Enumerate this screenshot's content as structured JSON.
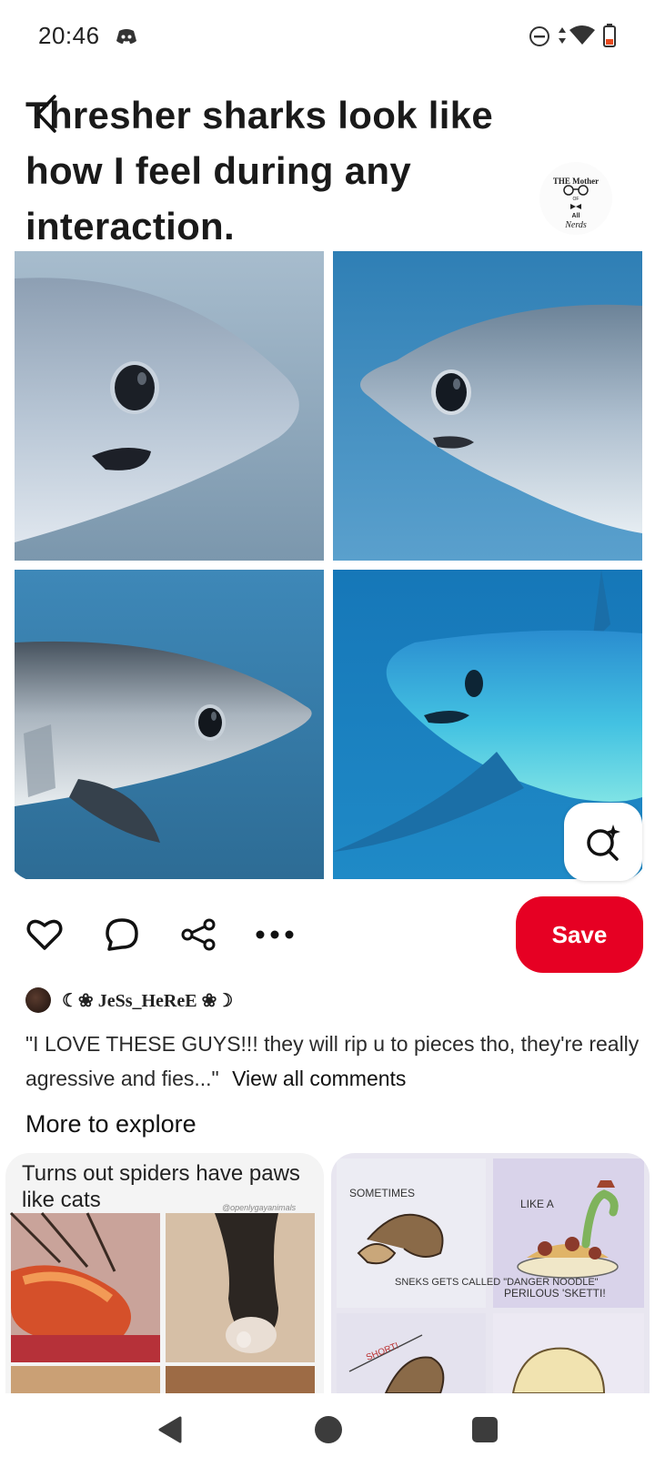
{
  "status_bar": {
    "time": "20:46",
    "icons": [
      "discord-icon",
      "do-not-disturb-icon",
      "data-arrows-icon",
      "wifi-icon",
      "battery-low-icon"
    ],
    "battery_color": "#e8491e"
  },
  "pin": {
    "caption": "Thresher sharks look like how I feel during any interaction.",
    "watermark": "THE Mother OF All Nerds",
    "images": [
      "thresher-shark-photo",
      "thresher-shark-photo",
      "thresher-shark-photo",
      "thresher-shark-photo"
    ]
  },
  "actions": {
    "save_label": "Save",
    "icons": [
      "heart-icon",
      "comment-icon",
      "share-icon",
      "more-icon"
    ],
    "accent_color": "#e60023"
  },
  "comment": {
    "author": "☾❀ JeSs_HeReE ❀☽",
    "text": "\"I LOVE THESE GUYS!!! they will rip u to pieces tho, they're really agressive and fies...\"",
    "view_all": "View all comments"
  },
  "explore": {
    "title": "More to explore",
    "cards": [
      {
        "caption": "Turns out spiders have paws like cats",
        "handle": "@openlygayanimals"
      },
      {
        "texts": [
          "SOMETIMES",
          "SNEKS GETS CALLED \"DANGER NOODLE\"",
          "LIKE A",
          "PERILOUS 'SKETTI!",
          "SHORT!"
        ]
      }
    ]
  },
  "nav_bar": {
    "icons": [
      "back-triangle-icon",
      "home-circle-icon",
      "recents-square-icon"
    ]
  }
}
